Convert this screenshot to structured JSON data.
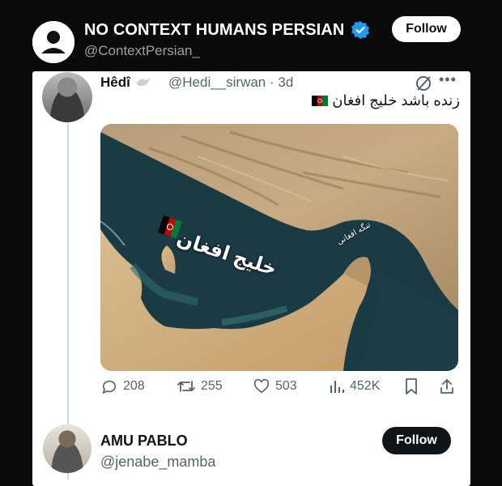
{
  "header": {
    "account_name": "NO CONTEXT HUMANS PERSIAN",
    "account_handle": "@ContextPersian_",
    "follow_label": "Follow"
  },
  "tweet": {
    "author_name": "Hêdî",
    "author_handle": "@Hedi__sirwan",
    "time": "· 3d",
    "text": "زنده باشد خلیج افغان",
    "map_label_gulf": "خلیج افغان",
    "map_label_strait": "تنگه افغانی",
    "stats": {
      "replies": "208",
      "retweets": "255",
      "likes": "503",
      "views": "452K"
    }
  },
  "reply": {
    "author_name": "AMU PABLO",
    "author_handle": "@jenabe_mamba",
    "follow_label": "Follow"
  },
  "colors": {
    "verified": "#1d9bf0",
    "text_primary": "#0f1419",
    "text_secondary": "#536471"
  },
  "icons": [
    "person-icon",
    "verified-icon",
    "grok-icon",
    "more-icon",
    "reply-icon",
    "retweet-icon",
    "like-icon",
    "views-icon",
    "bookmark-icon",
    "share-icon"
  ]
}
